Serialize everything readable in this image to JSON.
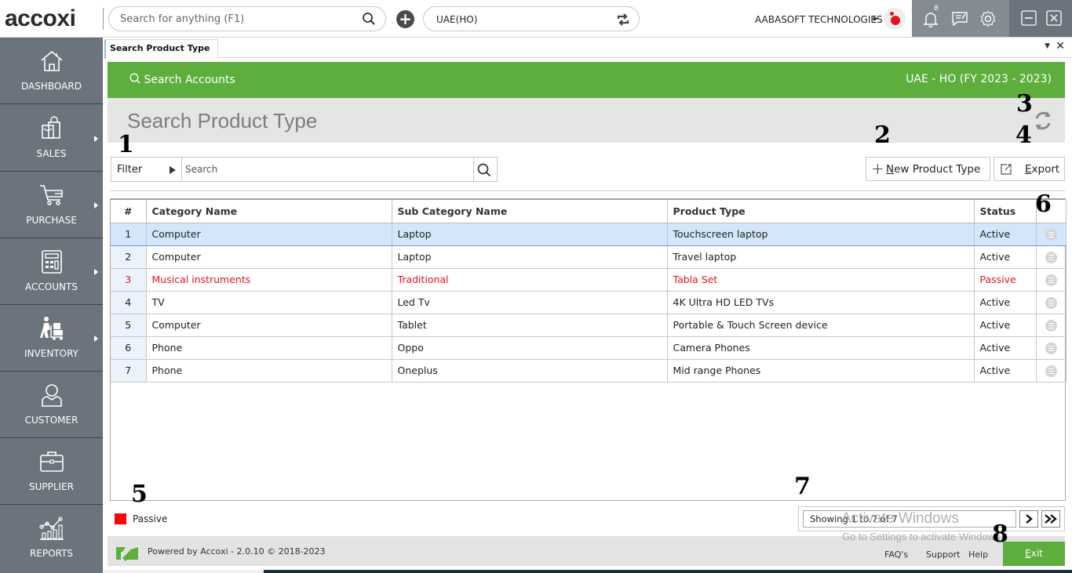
{
  "app": {
    "logo": "accoxi",
    "global_search_placeholder": "Search for anything (F1)",
    "branch": "UAE(HO)",
    "company": "AABASOFT TECHNOLOGIES",
    "notification_count": "8"
  },
  "sidebar": {
    "items": [
      {
        "label": "DASHBOARD",
        "icon": "home-icon",
        "has_submenu": false
      },
      {
        "label": "SALES",
        "icon": "shopping-bag-icon",
        "has_submenu": true
      },
      {
        "label": "PURCHASE",
        "icon": "cart-icon",
        "has_submenu": true
      },
      {
        "label": "ACCOUNTS",
        "icon": "calculator-icon",
        "has_submenu": true
      },
      {
        "label": "INVENTORY",
        "icon": "trolley-icon",
        "has_submenu": true
      },
      {
        "label": "CUSTOMER",
        "icon": "user-icon",
        "has_submenu": false
      },
      {
        "label": "SUPPLIER",
        "icon": "briefcase-icon",
        "has_submenu": false
      },
      {
        "label": "REPORTS",
        "icon": "chart-icon",
        "has_submenu": false
      }
    ]
  },
  "tabs": [
    {
      "label": "Search Product Type",
      "active": true
    }
  ],
  "header": {
    "search_accounts": "Search Accounts",
    "fiscal": "UAE - HO (FY 2023 - 2023)",
    "page_title": "Search Product Type"
  },
  "toolbar": {
    "filter_label": "Filter",
    "search_placeholder": "Search",
    "search_value": "",
    "new_label_prefix": "",
    "new_label_underlined": "N",
    "new_label_rest": "ew Product Type",
    "export_underlined": "E",
    "export_rest": "xport"
  },
  "table": {
    "columns": [
      "#",
      "Category Name",
      "Sub Category Name",
      "Product Type",
      "Status",
      ""
    ],
    "rows": [
      {
        "num": "1",
        "category": "Computer",
        "sub_category": "Laptop",
        "product_type": "Touchscreen laptop",
        "status": "Active"
      },
      {
        "num": "2",
        "category": "Computer",
        "sub_category": "Laptop",
        "product_type": "Travel laptop",
        "status": "Active"
      },
      {
        "num": "3",
        "category": "Musical instruments",
        "sub_category": "Traditional",
        "product_type": "Tabla Set",
        "status": "Passive"
      },
      {
        "num": "4",
        "category": "TV",
        "sub_category": "Led Tv",
        "product_type": "4K Ultra HD LED TVs",
        "status": "Active"
      },
      {
        "num": "5",
        "category": "Computer",
        "sub_category": "Tablet",
        "product_type": "Portable & Touch Screen device",
        "status": "Active"
      },
      {
        "num": "6",
        "category": "Phone",
        "sub_category": "Oppo",
        "product_type": "Camera Phones",
        "status": "Active"
      },
      {
        "num": "7",
        "category": "Phone",
        "sub_category": "Oneplus",
        "product_type": "Mid range Phones",
        "status": "Active"
      }
    ],
    "selected_row": 0
  },
  "legend": {
    "label": "Passive",
    "color": "#ff0000"
  },
  "pagination": {
    "info": "Showing 1 to 7 of 7",
    "next": "›",
    "last": "»"
  },
  "footer": {
    "powered": "Powered by Accoxi - 2.0.10 © 2018-2023",
    "links": [
      "FAQ's",
      "Support",
      "Help"
    ],
    "exit_underlined": "E",
    "exit_rest": "xit"
  },
  "annotations": [
    "1",
    "2",
    "3",
    "4",
    "5",
    "6",
    "7",
    "8"
  ],
  "watermark": {
    "line1": "Activate Windows",
    "line2": "Go to Settings to activate Windows."
  },
  "colors": {
    "brand_green": "#5dae3c",
    "sidebar": "#6b747c",
    "passive_red": "#e8141e",
    "selected_row": "#d3e6fa"
  }
}
